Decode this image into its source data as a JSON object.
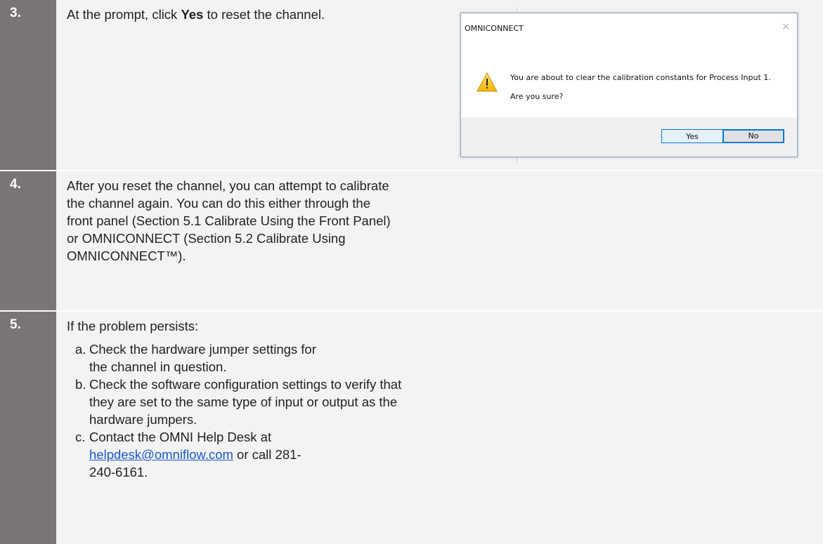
{
  "steps": [
    {
      "number": "3.",
      "text_before": "At the prompt, click ",
      "text_bold": "Yes",
      "text_after": " to reset the channel."
    },
    {
      "number": "4.",
      "text": "After you reset the channel, you can attempt to calibrate the channel again. You can do this either through the front panel (Section 5.1 Calibrate Using the Front Panel) or OMNICONNECT (Section 5.2 Calibrate Using OMNICONNECT™)."
    },
    {
      "number": "5.",
      "intro": "If the problem persists:",
      "items": [
        {
          "marker": "a.",
          "text": "Check the hardware jumper settings for the channel in question."
        },
        {
          "marker": "b.",
          "text": "Check the software configuration settings to verify that they are set to the same type of input or output as the hardware jumpers."
        },
        {
          "marker": "c.",
          "text_before": "Contact the OMNI Help Desk at ",
          "link": "helpdesk@omniflow.com",
          "text_after": " or call 281-240-6161."
        }
      ]
    }
  ],
  "dialog": {
    "title": "OMNICONNECT",
    "close_glyph": "×",
    "message": "You are about to clear the calibration constants for Process Input 1.",
    "question": "Are you sure?",
    "yes_label": "Yes",
    "no_label": "No",
    "icon": "warning-triangle-icon"
  },
  "colors": {
    "number_cell": "#7a7575",
    "content_cell": "#f3f3f3",
    "link": "#1a56c8",
    "dialog_accent": "#0078d7"
  }
}
